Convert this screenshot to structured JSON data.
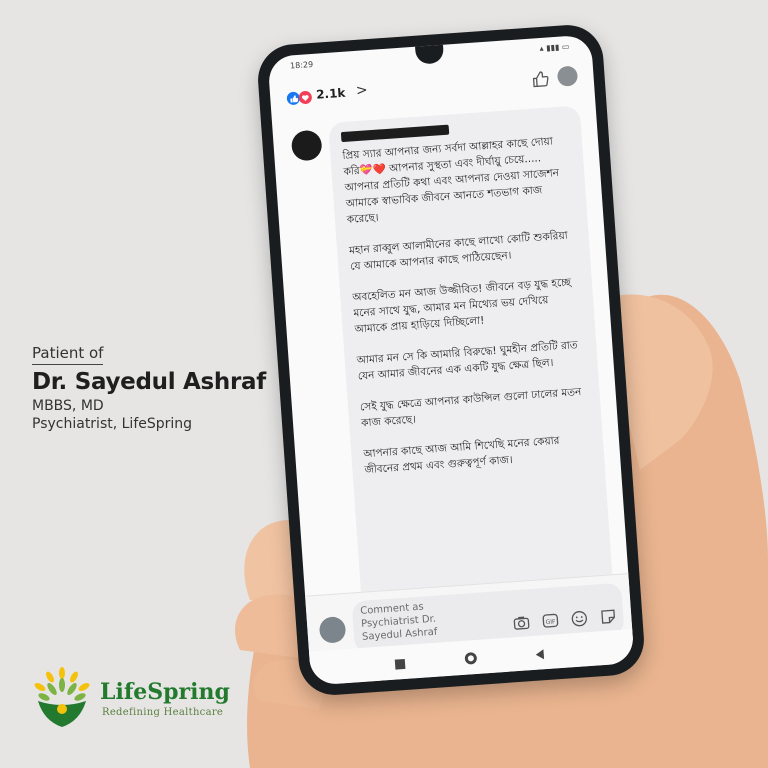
{
  "caption": {
    "prefix": "Patient of",
    "doctor_name": "Dr. Sayedul Ashraf",
    "degrees": "MBBS, MD",
    "role": "Psychiatrist, LifeSpring"
  },
  "brand": {
    "name": "LifeSpring",
    "tagline": "Redefining Healthcare",
    "colors": {
      "green": "#237a2e",
      "leaf": "#7cb342",
      "yellow": "#f4c20d"
    }
  },
  "status_bar": {
    "time": "18:29"
  },
  "post": {
    "reaction_count": "2.1k",
    "reaction_icons": [
      "like-icon",
      "love-icon"
    ],
    "chevron": ">"
  },
  "comment": {
    "paragraphs": [
      "প্রিয় স্যার আপনার জন্য সর্বদা আল্লাহর কাছে দোয়া করি💝❤️ আপনার সুস্থতা এবং দীর্ঘায়ু চেয়ে..... আপনার প্রতিটি কথা এবং আপনার দেওয়া সাজেশন আমাকে স্বাভাবিক জীবনে আনতে শতভাগ কাজ করেছে।",
      "মহান রাব্বুল আলামীনের কাছে লাখো কোটি শুকরিয়া যে আমাকে আপনার কাছে পাঠিয়েছেন।",
      "অবহেলিত মন আজ উজ্জীবিত! জীবনে বড় যুদ্ধ হচ্ছে মনের সাথে যুদ্ধ, আমার মন মিথ্যের ভয় দেখিয়ে আমাকে প্রায় হাড়িয়ে দিচ্ছিলো!",
      "আমার মন সে কি আমারি বিরুদ্ধে! ঘুমহীন প্রতিটি রাত যেন আমার জীবনের এক একটি যুদ্ধ ক্ষেত্র ছিল।",
      "সেই যুদ্ধ ক্ষেত্রে আপনার কাউন্সিল গুলো ঢালের মতন কাজ করেছে।",
      "আপনার কাছে আজ আমি শিখেছি মনের কেয়ার জীবনের প্রথম এবং গুরুত্বপূর্ণ কাজ।"
    ]
  },
  "composer": {
    "placeholder": "Comment as Psychiatrist Dr. Sayedul Ashraf",
    "icons": [
      "camera-icon",
      "gif-icon",
      "emoji-icon",
      "sticker-icon"
    ]
  },
  "nav": {
    "icons": [
      "recents-icon",
      "home-icon",
      "back-icon"
    ]
  }
}
